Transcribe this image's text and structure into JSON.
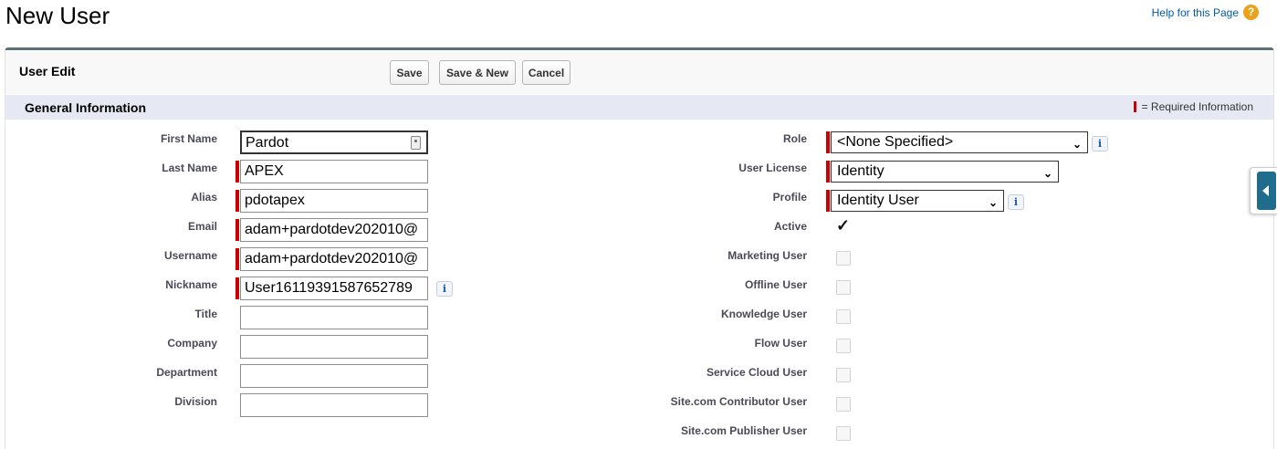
{
  "page": {
    "title": "New User",
    "help_label": "Help for this Page"
  },
  "header": {
    "title": "User Edit",
    "save_label": "Save",
    "save_new_label": "Save & New",
    "cancel_label": "Cancel"
  },
  "section": {
    "title": "General Information",
    "required_legend": "= Required Information"
  },
  "left_fields": {
    "first_name": {
      "label": "First Name",
      "value": "Pardot"
    },
    "last_name": {
      "label": "Last Name",
      "value": "APEX"
    },
    "alias": {
      "label": "Alias",
      "value": "pdotapex"
    },
    "email": {
      "label": "Email",
      "value": "adam+pardotdev202010@"
    },
    "username": {
      "label": "Username",
      "value": "adam+pardotdev202010@"
    },
    "nickname": {
      "label": "Nickname",
      "value": "User16119391587652789"
    },
    "title": {
      "label": "Title",
      "value": ""
    },
    "company": {
      "label": "Company",
      "value": ""
    },
    "department": {
      "label": "Department",
      "value": ""
    },
    "division": {
      "label": "Division",
      "value": ""
    }
  },
  "right_fields": {
    "role": {
      "label": "Role",
      "value": "<None Specified>"
    },
    "user_license": {
      "label": "User License",
      "value": "Identity"
    },
    "profile": {
      "label": "Profile",
      "value": "Identity User"
    },
    "active": {
      "label": "Active",
      "checked": true
    },
    "marketing_user": {
      "label": "Marketing User",
      "checked": false
    },
    "offline_user": {
      "label": "Offline User",
      "checked": false
    },
    "knowledge_user": {
      "label": "Knowledge User",
      "checked": false
    },
    "flow_user": {
      "label": "Flow User",
      "checked": false
    },
    "service_cloud_user": {
      "label": "Service Cloud User",
      "checked": false
    },
    "site_contributor_user": {
      "label": "Site.com Contributor User",
      "checked": false
    },
    "site_publisher_user": {
      "label": "Site.com Publisher User",
      "checked": false
    }
  },
  "icons": {
    "help": "help-question-icon",
    "info": "info-icon",
    "contact": "contact-card-icon",
    "side_tab": "chevron-left-icon",
    "check": "✓",
    "chevron": "⌄"
  },
  "colors": {
    "required": "#cc0000",
    "section_bar": "#e6e9f3",
    "panel_border": "#5d7078",
    "link": "#015ba7",
    "help_icon": "#e8a21c",
    "side_tab": "#1f6c8c"
  }
}
